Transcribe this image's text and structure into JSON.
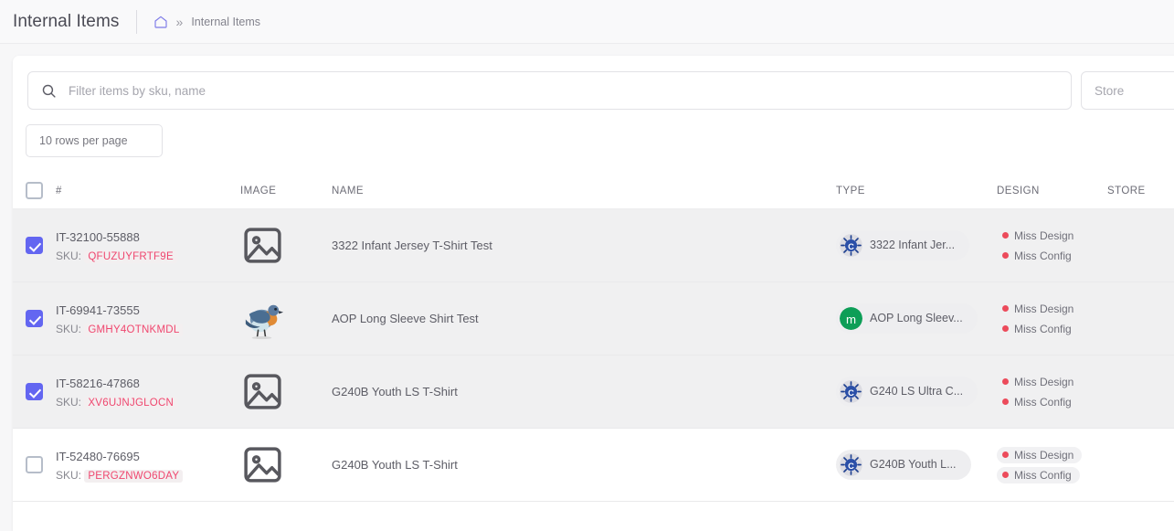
{
  "header": {
    "title": "Internal Items",
    "home_icon": "home-icon",
    "separator": "»",
    "breadcrumb": "Internal Items"
  },
  "filters": {
    "search_icon": "search-icon",
    "search_placeholder": "Filter items by sku, name",
    "search_value": "",
    "store_placeholder": "Store",
    "store_value": "",
    "rows_per_page": "10 rows per page"
  },
  "table": {
    "columns": {
      "num": "#",
      "image": "IMAGE",
      "name": "NAME",
      "type": "TYPE",
      "design": "DESIGN",
      "store": "STORE"
    },
    "sku_label": "SKU:",
    "header_checked": false,
    "rows": [
      {
        "id": "IT-32100-55888",
        "sku": "QFUZUYFRTF9E",
        "name": "3322 Infant Jersey T-Shirt Test",
        "image_kind": "placeholder-image-icon",
        "type_label": "3322 Infant Jer...",
        "type_logo": "blue-gear-c-logo",
        "design": [
          "Miss Design",
          "Miss Config"
        ],
        "design_boxed": false,
        "checked": true,
        "selected": true
      },
      {
        "id": "IT-69941-73555",
        "sku": "GMHY4OTNKMDL",
        "name": "AOP Long Sleeve Shirt Test",
        "image_kind": "bluebird-photo",
        "type_label": "AOP Long Sleev...",
        "type_logo": "green-m-logo",
        "design": [
          "Miss Design",
          "Miss Config"
        ],
        "design_boxed": false,
        "checked": true,
        "selected": true
      },
      {
        "id": "IT-58216-47868",
        "sku": "XV6UJNJGLOCN",
        "name": "G240B Youth LS T-Shirt",
        "image_kind": "placeholder-image-icon",
        "type_label": "G240 LS Ultra C...",
        "type_logo": "blue-gear-c-logo",
        "design": [
          "Miss Design",
          "Miss Config"
        ],
        "design_boxed": false,
        "checked": true,
        "selected": true
      },
      {
        "id": "IT-52480-76695",
        "sku": "PERGZNWO6DAY",
        "name": "G240B Youth LS T-Shirt",
        "image_kind": "placeholder-image-icon",
        "type_label": "G240B Youth L...",
        "type_logo": "blue-gear-c-logo",
        "design": [
          "Miss Design",
          "Miss Config"
        ],
        "design_boxed": true,
        "checked": false,
        "selected": false
      }
    ]
  },
  "colors": {
    "accent_purple": "#6366f1",
    "sku_pink": "#ef476f",
    "status_red": "#ec4b5b",
    "selected_row": "#f0f0f1",
    "page_bg": "#f7f7f8"
  }
}
